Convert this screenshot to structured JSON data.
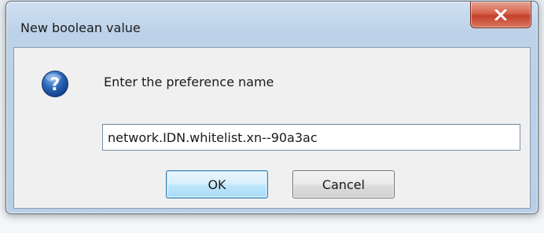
{
  "window": {
    "title": "New boolean value",
    "close_label": "X"
  },
  "dialog": {
    "icon": "question-icon",
    "prompt": "Enter the preference name",
    "input_value": "network.IDN.whitelist.xn--90a3ac",
    "ok_label": "OK",
    "cancel_label": "Cancel"
  },
  "colors": {
    "close_button": "#c4402a",
    "ok_button_border": "#3c7fb1",
    "icon_blue": "#2a64b6"
  }
}
